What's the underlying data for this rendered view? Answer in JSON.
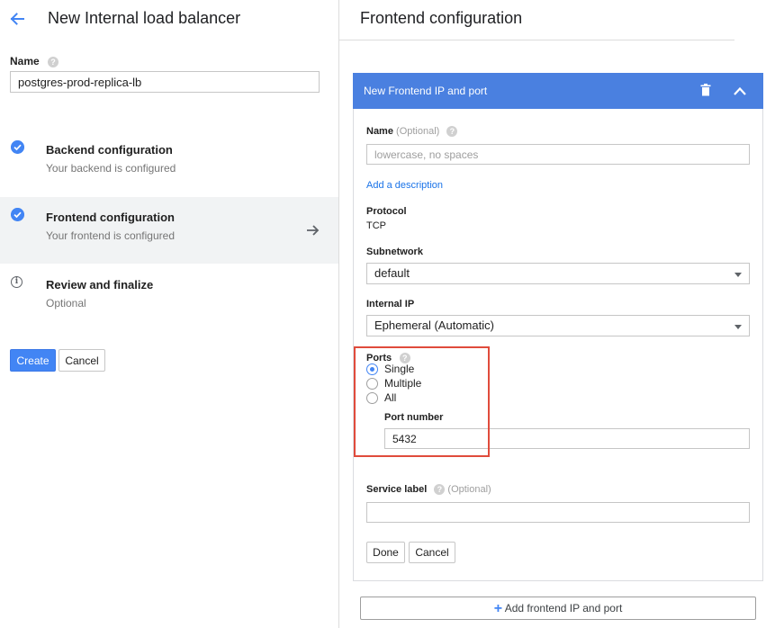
{
  "left": {
    "title": "New Internal load balancer",
    "name_label": "Name",
    "help_glyph": "?",
    "name_value": "postgres-prod-replica-lb",
    "steps": [
      {
        "title": "Backend configuration",
        "subtitle": "Your backend is configured",
        "status": "complete"
      },
      {
        "title": "Frontend configuration",
        "subtitle": "Your frontend is configured",
        "status": "complete-active"
      },
      {
        "title": "Review and finalize",
        "subtitle": "Optional",
        "status": "info"
      }
    ],
    "create_label": "Create",
    "cancel_label": "Cancel",
    "icons": {
      "back": "arrow-back-icon",
      "check": "check-circle-icon",
      "info": "info-icon",
      "forward": "arrow-forward-icon"
    }
  },
  "right": {
    "title": "Frontend configuration",
    "panel": {
      "header_title": "New Frontend IP and port",
      "icons": {
        "delete": "trash-icon",
        "collapse": "chevron-up-icon"
      },
      "name_label": "Name",
      "optional_tag": "(Optional)",
      "name_placeholder": "lowercase, no spaces",
      "add_description": "Add a description",
      "protocol_label": "Protocol",
      "protocol_value": "TCP",
      "subnetwork_label": "Subnetwork",
      "subnetwork_value": "default",
      "internal_ip_label": "Internal IP",
      "internal_ip_value": "Ephemeral (Automatic)",
      "ports_label": "Ports",
      "ports_options": [
        "Single",
        "Multiple",
        "All"
      ],
      "ports_selected": "Single",
      "port_number_label": "Port number",
      "port_number_value": "5432",
      "service_label_label": "Service label",
      "service_label_optional": "(Optional)",
      "service_label_value": "",
      "done_label": "Done",
      "cancel_label": "Cancel"
    },
    "add_frontend_label": "Add frontend IP and port",
    "add_glyph": "+"
  },
  "colors": {
    "accent": "#4285f4",
    "header_blue": "#4a80e0",
    "highlight_red": "#e04b3c",
    "active_step_bg": "#f1f3f4"
  }
}
